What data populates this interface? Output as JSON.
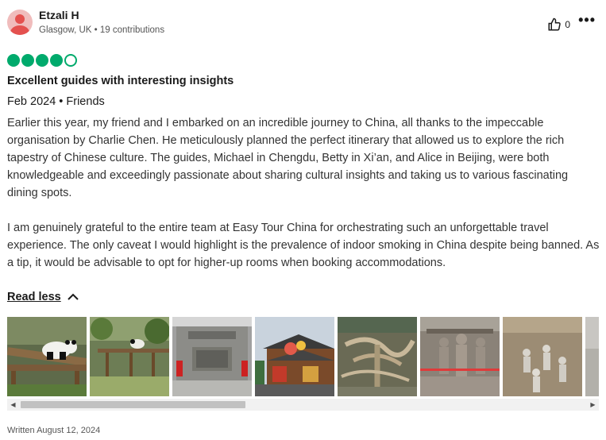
{
  "user": {
    "name": "Etzali H",
    "meta": "Glasgow, UK • 19 contributions",
    "avatar_color": "#e4514f"
  },
  "actions": {
    "like_count": "0",
    "like_icon": "thumbs-up-icon",
    "more_icon": "more-options-icon"
  },
  "rating": {
    "value": 4,
    "max": 5,
    "color": "#00aa6c"
  },
  "review": {
    "title": "Excellent guides with interesting insights",
    "trip": "Feb 2024 • Friends",
    "paragraph1": "Earlier this year, my friend and I embarked on an incredible journey to China, all thanks to the impeccable organisation by Charlie Chen. He meticulously planned the perfect itinerary that allowed us to explore the rich tapestry of Chinese culture. The guides, Michael in Chengdu, Betty in Xi’an, and Alice in Beijing, were both knowledgeable and exceedingly passionate about sharing cultural insights and taking us to various fascinating dining spots.",
    "paragraph2": "I am genuinely grateful to the entire team at Easy Tour China for orchestrating such an unforgettable travel experience. The only caveat I would highlight is the prevalence of indoor smoking in China despite being banned. As a tip, it would be advisable to opt for higher-up rooms when booking accommodations.",
    "read_less": "Read less"
  },
  "photos": [
    {
      "subject": "panda"
    },
    {
      "subject": "panda-enclosure"
    },
    {
      "subject": "city-gate"
    },
    {
      "subject": "pagoda-street"
    },
    {
      "subject": "ancient-tree"
    },
    {
      "subject": "terracotta-warriors"
    },
    {
      "subject": "terracotta-pit"
    },
    {
      "subject": "partial"
    }
  ],
  "scroll": {
    "left_icon": "scroll-left-arrow-icon",
    "right_icon": "scroll-right-arrow-icon"
  },
  "written": "Written August 12, 2024"
}
